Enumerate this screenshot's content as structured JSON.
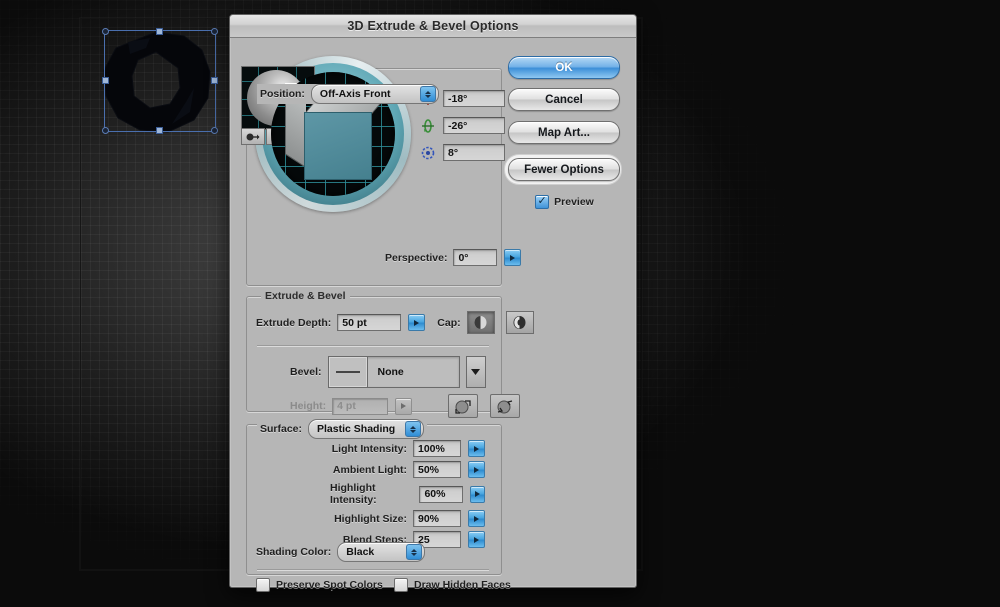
{
  "dialog": {
    "title": "3D Extrude & Bevel Options",
    "position": {
      "label": "Position:",
      "value": "Off-Axis Front",
      "rotate_x": "-18°",
      "rotate_y": "-26°",
      "rotate_z": "8°",
      "perspective_label": "Perspective:",
      "perspective_value": "0°",
      "axis_x_icon": "rotate-x-icon",
      "axis_y_icon": "rotate-y-icon",
      "axis_z_icon": "rotate-z-icon"
    },
    "buttons": {
      "ok": "OK",
      "cancel": "Cancel",
      "map_art": "Map Art...",
      "fewer_options": "Fewer Options",
      "preview": "Preview",
      "preview_checked": true
    },
    "extrude": {
      "group_label": "Extrude & Bevel",
      "depth_label": "Extrude Depth:",
      "depth_value": "50 pt",
      "cap_label": "Cap:",
      "cap_solid_icon": "cap-solid-icon",
      "cap_hollow_icon": "cap-hollow-icon",
      "bevel_label": "Bevel:",
      "bevel_value": "None",
      "height_label": "Height:",
      "height_value": "4 pt",
      "bevel_out_icon": "bevel-extent-out-icon",
      "bevel_in_icon": "bevel-extent-in-icon"
    },
    "surface": {
      "group_label": "Surface:",
      "shading_value": "Plastic Shading",
      "light_new_icon": "new-light-icon",
      "light_duplicate_icon": "duplicate-light-icon",
      "light_delete_icon": "delete-light-icon",
      "params": [
        {
          "label": "Light Intensity:",
          "value": "100%"
        },
        {
          "label": "Ambient Light:",
          "value": "50%"
        },
        {
          "label": "Highlight Intensity:",
          "value": "60%"
        },
        {
          "label": "Highlight Size:",
          "value": "90%"
        },
        {
          "label": "Blend Steps:",
          "value": "25"
        }
      ],
      "shading_color_label": "Shading Color:",
      "shading_color_value": "Black",
      "preserve_spot_colors": "Preserve Spot Colors",
      "preserve_spot_checked": false,
      "draw_hidden_faces": "Draw Hidden Faces",
      "draw_hidden_checked": false
    }
  },
  "colors": {
    "dialog_bg": "#b6b6b6",
    "accent_blue": "#3d8fd8",
    "widget_teal": "#5fa7b5",
    "cube_face": "#4f8a99",
    "selection_blue": "#4a6fae"
  }
}
